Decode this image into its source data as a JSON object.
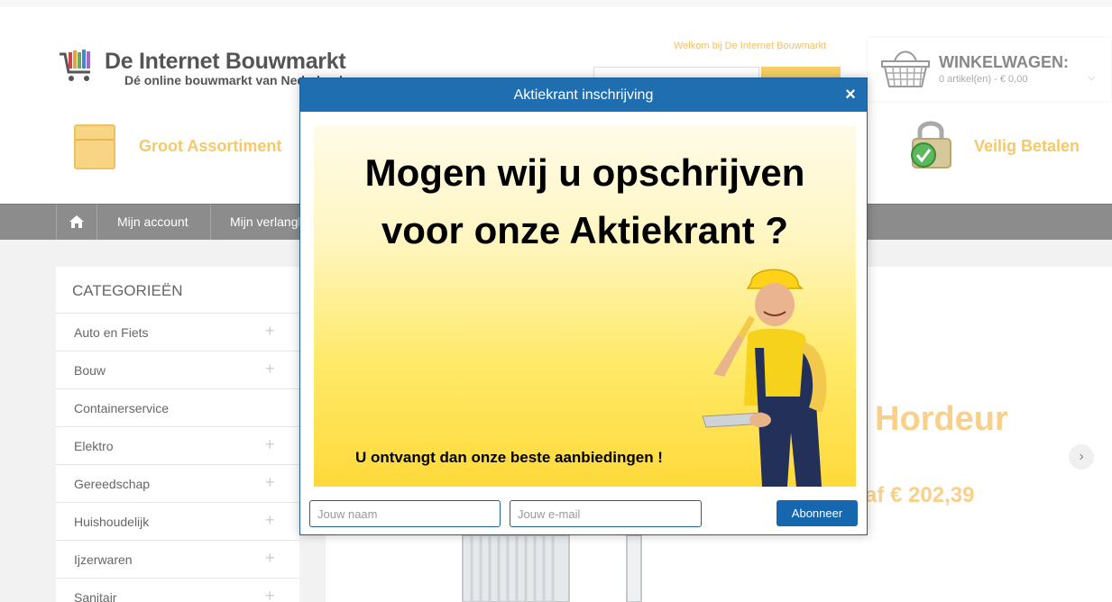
{
  "header": {
    "logo_title": "De Internet Bouwmarkt",
    "logo_subtitle": "Dé online bouwmarkt van Nederland",
    "welcome": "Welkom bij De Internet Bouwmarkt"
  },
  "cart": {
    "title": "WINKELWAGEN:",
    "summary": "0 artikel(en) - € 0,00"
  },
  "usps": [
    {
      "label": "Groot Assortiment",
      "icon": "box-icon"
    },
    {
      "label": "Veilig Betalen",
      "icon": "lock-icon"
    }
  ],
  "nav": {
    "home_icon": "home-icon",
    "items": [
      "Mijn account",
      "Mijn verlanglijst"
    ]
  },
  "categories": {
    "title": "CATEGORIEËN",
    "items": [
      {
        "label": "Auto en Fiets",
        "expandable": true
      },
      {
        "label": "Bouw",
        "expandable": true
      },
      {
        "label": "Containerservice",
        "expandable": false
      },
      {
        "label": "Elektro",
        "expandable": true
      },
      {
        "label": "Gereedschap",
        "expandable": true
      },
      {
        "label": "Huishoudelijk",
        "expandable": true
      },
      {
        "label": "Ijzerwaren",
        "expandable": true
      },
      {
        "label": "Sanitair",
        "expandable": true
      }
    ]
  },
  "slider": {
    "title": "Hordeur",
    "price": "af € 202,39",
    "next_icon": "chevron-right-icon"
  },
  "modal": {
    "title": "Aktiekrant inschrijving",
    "close": "×",
    "banner_heading_line1": "Mogen wij u opschrijven",
    "banner_heading_line2": "voor onze Aktiekrant ?",
    "banner_sub": "U ontvangt dan onze beste aanbiedingen !",
    "name_placeholder": "Jouw naam",
    "email_placeholder": "Jouw e-mail",
    "subscribe_label": "Abonneer"
  },
  "colors": {
    "modal_header": "#1f6fb0",
    "button": "#1767b0",
    "navbar": "#8c8c8c",
    "accent": "#f5c96a"
  }
}
